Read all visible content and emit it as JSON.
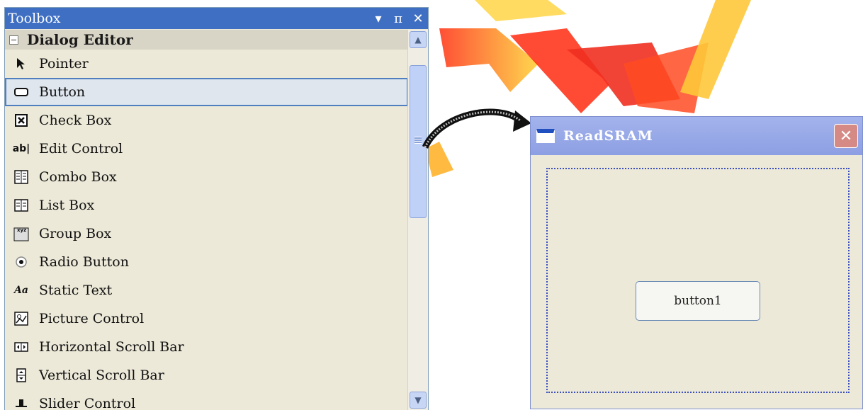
{
  "toolbox": {
    "title": "Toolbox",
    "controls": {
      "dropdown": "▾",
      "pin": "ᴨ",
      "close": "✕"
    },
    "section": "Dialog Editor",
    "items": [
      {
        "label": "Pointer",
        "icon": "pointer-icon"
      },
      {
        "label": "Button",
        "icon": "button-icon",
        "selected": true
      },
      {
        "label": "Check Box",
        "icon": "check-box-icon"
      },
      {
        "label": "Edit Control",
        "icon": "edit-control-icon"
      },
      {
        "label": "Combo Box",
        "icon": "combo-box-icon"
      },
      {
        "label": "List Box",
        "icon": "list-box-icon"
      },
      {
        "label": "Group Box",
        "icon": "group-box-icon"
      },
      {
        "label": "Radio Button",
        "icon": "radio-button-icon"
      },
      {
        "label": "Static Text",
        "icon": "static-text-icon"
      },
      {
        "label": "Picture Control",
        "icon": "picture-control-icon"
      },
      {
        "label": "Horizontal Scroll Bar",
        "icon": "horizontal-scroll-bar-icon"
      },
      {
        "label": "Vertical Scroll Bar",
        "icon": "vertical-scroll-bar-icon"
      },
      {
        "label": "Slider Control",
        "icon": "slider-control-icon"
      }
    ]
  },
  "dialog": {
    "title": "ReadSRAM",
    "button_label": "button1"
  },
  "colors": {
    "toolbox_title_bg": "#3f6fc3",
    "dialog_title_bg": "#8d9fe3",
    "close_button": "#d68a86",
    "selection_border": "#4f7fbf",
    "watermark": "#e8000a"
  }
}
